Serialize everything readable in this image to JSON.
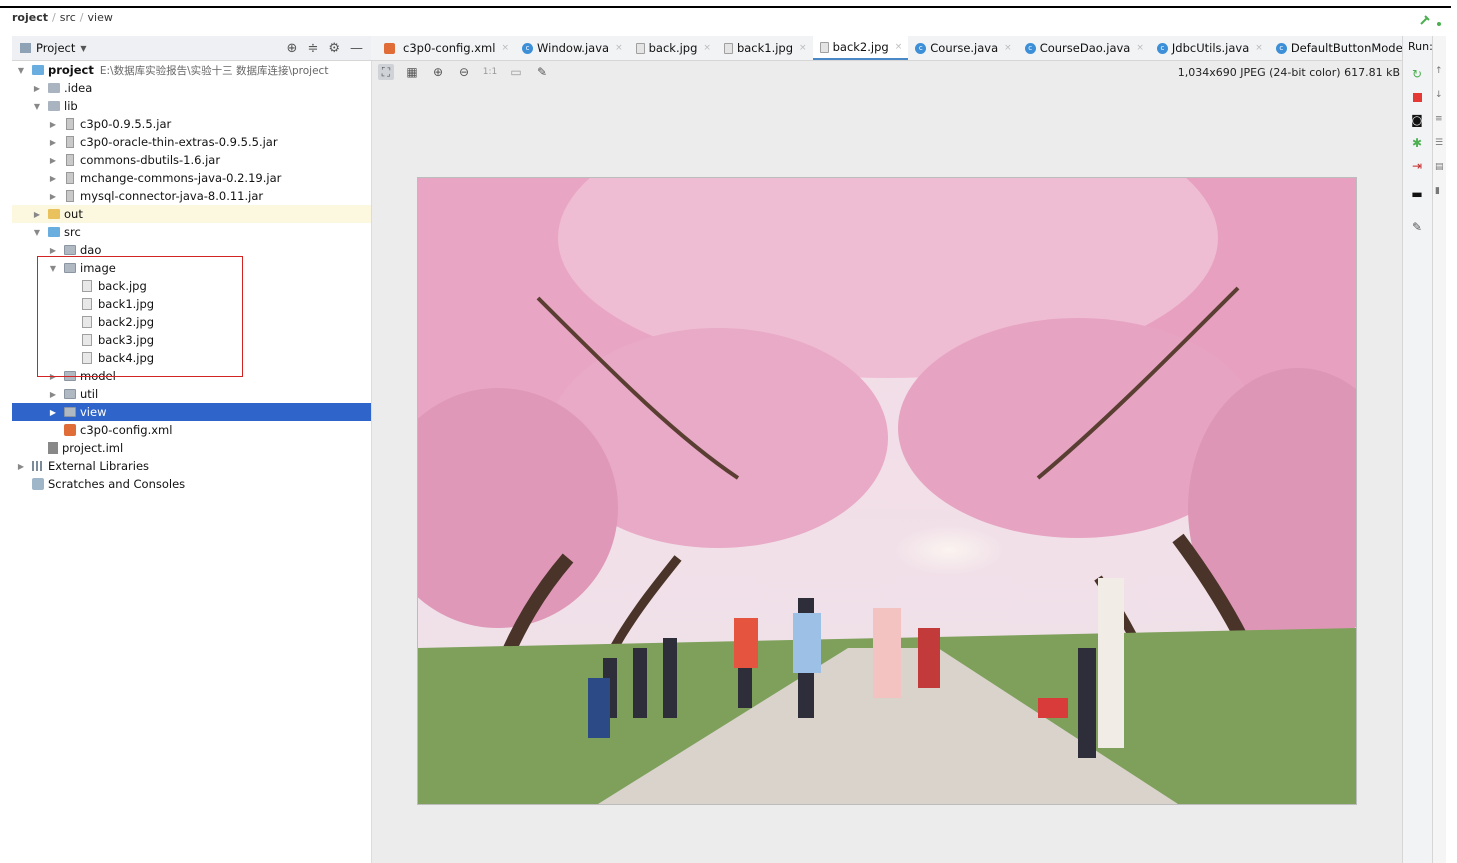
{
  "breadcrumb": {
    "project": "roject",
    "src": "src",
    "view": "view"
  },
  "project_panel": {
    "title": "Project",
    "tree": [
      {
        "label": "project",
        "path": "E:\\数据库实验报告\\实验十三  数据库连接\\project",
        "indent": 0,
        "arrow": "▼",
        "icon": "folder-blue",
        "bold": true
      },
      {
        "label": ".idea",
        "indent": 1,
        "arrow": "▶",
        "icon": "folder"
      },
      {
        "label": "lib",
        "indent": 1,
        "arrow": "▼",
        "icon": "folder"
      },
      {
        "label": "c3p0-0.9.5.5.jar",
        "indent": 2,
        "arrow": "▶",
        "icon": "jar"
      },
      {
        "label": "c3p0-oracle-thin-extras-0.9.5.5.jar",
        "indent": 2,
        "arrow": "▶",
        "icon": "jar"
      },
      {
        "label": "commons-dbutils-1.6.jar",
        "indent": 2,
        "arrow": "▶",
        "icon": "jar"
      },
      {
        "label": "mchange-commons-java-0.2.19.jar",
        "indent": 2,
        "arrow": "▶",
        "icon": "jar"
      },
      {
        "label": "mysql-connector-java-8.0.11.jar",
        "indent": 2,
        "arrow": "▶",
        "icon": "jar"
      },
      {
        "label": "out",
        "indent": 1,
        "arrow": "▶",
        "icon": "folder-yellow",
        "highlight": true
      },
      {
        "label": "src",
        "indent": 1,
        "arrow": "▼",
        "icon": "folder-blue"
      },
      {
        "label": "dao",
        "indent": 2,
        "arrow": "▶",
        "icon": "package"
      },
      {
        "label": "image",
        "indent": 2,
        "arrow": "▼",
        "icon": "package"
      },
      {
        "label": "back.jpg",
        "indent": 3,
        "arrow": "",
        "icon": "image"
      },
      {
        "label": "back1.jpg",
        "indent": 3,
        "arrow": "",
        "icon": "image"
      },
      {
        "label": "back2.jpg",
        "indent": 3,
        "arrow": "",
        "icon": "image"
      },
      {
        "label": "back3.jpg",
        "indent": 3,
        "arrow": "",
        "icon": "image"
      },
      {
        "label": "back4.jpg",
        "indent": 3,
        "arrow": "",
        "icon": "image"
      },
      {
        "label": "model",
        "indent": 2,
        "arrow": "▶",
        "icon": "package"
      },
      {
        "label": "util",
        "indent": 2,
        "arrow": "▶",
        "icon": "package"
      },
      {
        "label": "view",
        "indent": 2,
        "arrow": "▶",
        "icon": "package",
        "selected": true
      },
      {
        "label": "c3p0-config.xml",
        "indent": 2,
        "arrow": "",
        "icon": "xml"
      },
      {
        "label": "project.iml",
        "indent": 1,
        "arrow": "",
        "icon": "iml"
      },
      {
        "label": "External Libraries",
        "indent": 0,
        "arrow": "▶",
        "icon": "libraries"
      },
      {
        "label": "Scratches and Consoles",
        "indent": 0,
        "arrow": "",
        "icon": "scratches"
      }
    ]
  },
  "tabs": [
    {
      "label": "c3p0-config.xml",
      "icon": "xml"
    },
    {
      "label": "Window.java",
      "icon": "class"
    },
    {
      "label": "back.jpg",
      "icon": "image"
    },
    {
      "label": "back1.jpg",
      "icon": "image"
    },
    {
      "label": "back2.jpg",
      "icon": "image",
      "active": true
    },
    {
      "label": "Course.java",
      "icon": "class"
    },
    {
      "label": "CourseDao.java",
      "icon": "class"
    },
    {
      "label": "JdbcUtils.java",
      "icon": "class"
    },
    {
      "label": "DefaultButtonModel",
      "icon": "class"
    }
  ],
  "editor": {
    "image_info": "1,034x690 JPEG (24-bit color) 617.81 kB",
    "zoom_actual_label": "1:1"
  },
  "run_panel": {
    "label": "Run:"
  },
  "colors": {
    "selection": "#2f65ca",
    "annotation_box": "#d32424",
    "tab_underline": "#4a88c7"
  }
}
